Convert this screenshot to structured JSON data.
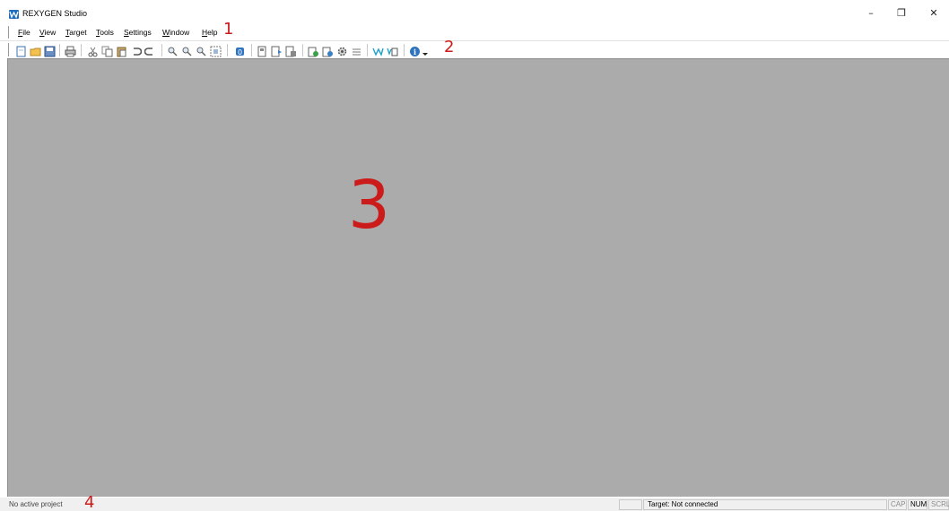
{
  "window": {
    "title": "REXYGEN Studio",
    "controls": {
      "minimize": "–",
      "maximize": "❐",
      "close": "✕"
    }
  },
  "menubar": {
    "items": [
      "File",
      "View",
      "Target",
      "Tools",
      "Settings",
      "Window",
      "Help"
    ]
  },
  "toolbar": {
    "icons": [
      "new-file-icon",
      "open-folder-icon",
      "save-icon",
      "print-icon",
      "cut-icon",
      "copy-icon",
      "paste-icon",
      "undo-icon",
      "redo-icon",
      "zoom-in-icon",
      "zoom-out-icon",
      "zoom-reset-icon",
      "zoom-fit-icon",
      "compile-icon",
      "target-connect-icon",
      "target-download-icon",
      "target-upload-icon",
      "diagnostics-icon",
      "monitor-icon",
      "settings-gear-icon",
      "list-icon",
      "watch-icon",
      "trend-icon",
      "info-icon",
      "dropdown-arrow-icon"
    ]
  },
  "callouts": {
    "menu": "1",
    "toolbar": "2",
    "workspace": "3",
    "status": "4"
  },
  "statusbar": {
    "message": "No active project",
    "target": "Target: Not connected",
    "cap": "CAP",
    "num": "NUM",
    "scrl": "SCRL"
  },
  "colors": {
    "workspace_bg": "#ababab",
    "callout_red": "#cc1b1b",
    "app_icon_blue": "#1f6fbf"
  }
}
